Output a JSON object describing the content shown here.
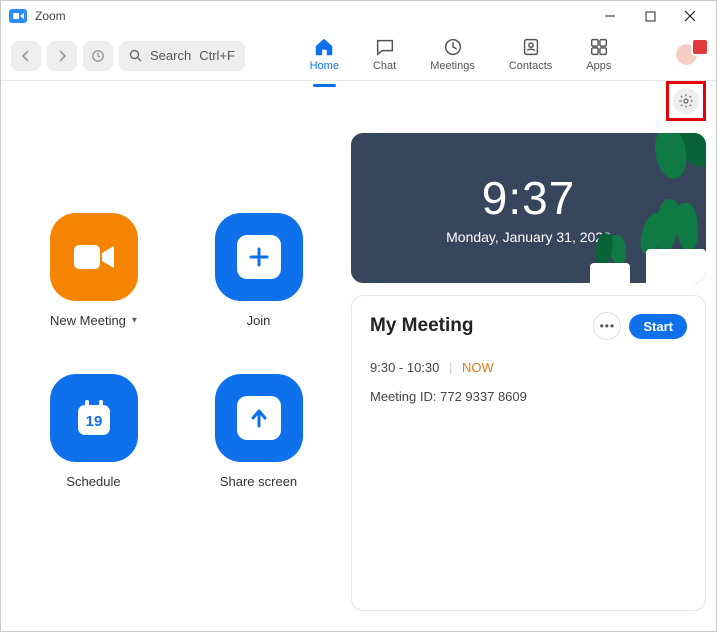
{
  "window": {
    "title": "Zoom"
  },
  "toolbar": {
    "search_placeholder": "Search",
    "search_shortcut": "Ctrl+F",
    "tabs": {
      "home": "Home",
      "chat": "Chat",
      "meetings": "Meetings",
      "contacts": "Contacts",
      "apps": "Apps"
    }
  },
  "actions": {
    "new_meeting": "New Meeting",
    "join": "Join",
    "schedule": "Schedule",
    "schedule_day": "19",
    "share_screen": "Share screen"
  },
  "clock": {
    "time": "9:37",
    "date": "Monday, January 31, 2022"
  },
  "meeting": {
    "title": "My Meeting",
    "start_label": "Start",
    "time_range": "9:30 - 10:30",
    "now_label": "NOW",
    "id_label": "Meeting ID:",
    "id_value": "772 9337 8609"
  }
}
